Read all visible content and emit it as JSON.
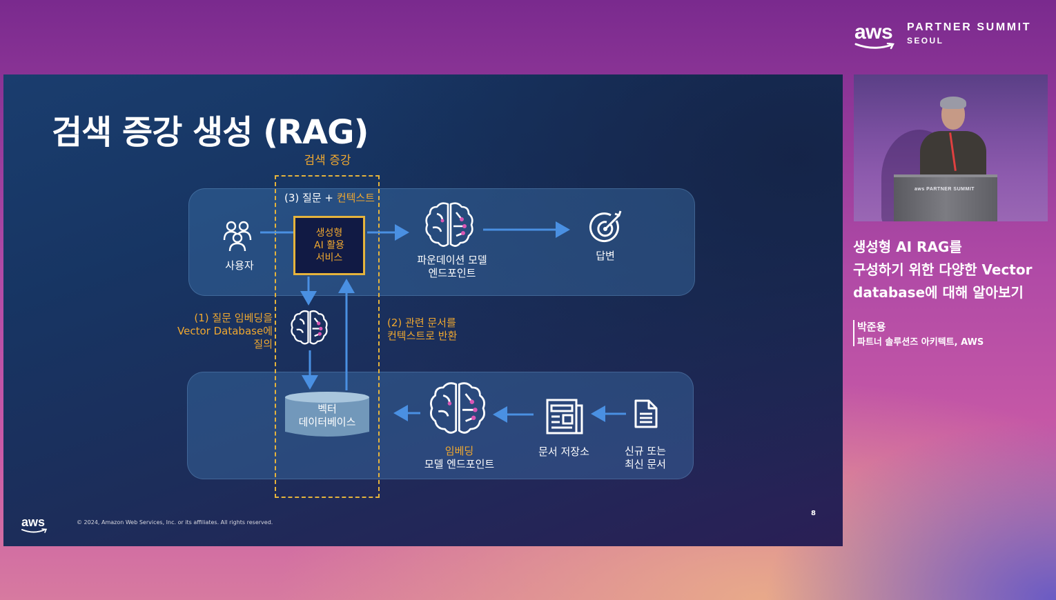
{
  "event": {
    "brand_logo": "aws",
    "title": "PARTNER SUMMIT",
    "subtitle": "SEOUL"
  },
  "slide": {
    "title": "검색 증강 생성 (RAG)",
    "retrieval_label": "검색 증강",
    "step3_prefix": "(3) 질문 + ",
    "step3_highlight": "컨텍스트",
    "user_label": "사용자",
    "gen_service_lines": [
      "생성형",
      "AI 활용",
      "서비스"
    ],
    "foundation_lines": [
      "파운데이션 모델",
      "엔드포인트"
    ],
    "answer_label": "답변",
    "step1_lines": [
      "(1) 질문 임베딩을",
      "Vector Database에",
      "질의"
    ],
    "step2_lines": [
      "(2) 관련 문서를",
      "컨텍스트로 반환"
    ],
    "vector_db_lines": [
      "벡터",
      "데이터베이스"
    ],
    "embedding_lines": [
      "임베딩",
      "모델 엔드포인트"
    ],
    "doc_store_label": "문서 저장소",
    "new_doc_lines": [
      "신규 또는",
      "최신 문서"
    ],
    "footer_logo": "aws",
    "copyright": "© 2024, Amazon Web Services, Inc. or its affiliates. All rights reserved.",
    "page_number": "8",
    "colors": {
      "accent_orange": "#f0a830",
      "dashed_border": "#e6b43c",
      "arrow_blue": "#4a90e2",
      "neural_pink": "#d957b5"
    }
  },
  "speaker_video": {
    "podium_text": "aws PARTNER SUMMIT"
  },
  "talk": {
    "title_lines": [
      "생성형 AI RAG를",
      "구성하기 위한 다양한 Vector",
      "database에 대해 알아보기"
    ],
    "speaker_name": "박준용",
    "speaker_role": "파트너 솔루션즈 아키텍트, AWS"
  }
}
